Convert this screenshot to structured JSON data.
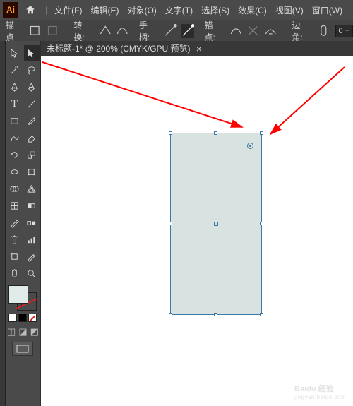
{
  "logo_text": "Ai",
  "menu": {
    "file": "文件(F)",
    "edit": "编辑(E)",
    "object": "对象(O)",
    "type": "文字(T)",
    "select": "选择(S)",
    "effect": "效果(C)",
    "view": "视图(V)",
    "window": "窗口(W)"
  },
  "control": {
    "anchor_label": "锚点",
    "convert_label": "转换:",
    "handle_label": "手柄:",
    "anchor2_label": "锚点:",
    "corners_label": "边角:",
    "corner_value": "0"
  },
  "tab": {
    "label": "未标题-1* @ 200% (CMYK/GPU 预览)"
  },
  "tools": {
    "selection": "selection-tool",
    "direct_selection": "direct-selection-tool",
    "magic_wand": "magic-wand-tool",
    "lasso": "lasso-tool",
    "pen": "pen-tool",
    "curvature": "curvature-tool",
    "type": "type-tool",
    "line": "line-segment-tool",
    "rectangle": "rectangle-tool",
    "paintbrush": "paintbrush-tool",
    "shaper": "shaper-tool",
    "eraser": "eraser-tool",
    "rotate": "rotate-tool",
    "scale": "scale-tool",
    "width": "width-tool",
    "free_transform": "free-transform-tool",
    "shape_builder": "shape-builder-tool",
    "perspective": "perspective-grid-tool",
    "mesh": "mesh-tool",
    "gradient": "gradient-tool",
    "eyedropper": "eyedropper-tool",
    "blend": "blend-tool",
    "symbol_sprayer": "symbol-sprayer-tool",
    "column_graph": "column-graph-tool",
    "artboard": "artboard-tool",
    "slice": "slice-tool",
    "hand": "hand-tool",
    "zoom": "zoom-tool"
  },
  "colors": {
    "fill": "#d8e2e0",
    "selection": "#3b7aa6",
    "arrow": "#ff0000"
  },
  "watermark": {
    "brand": "Baidu 经验",
    "url": "jingyan.baidu.com"
  }
}
